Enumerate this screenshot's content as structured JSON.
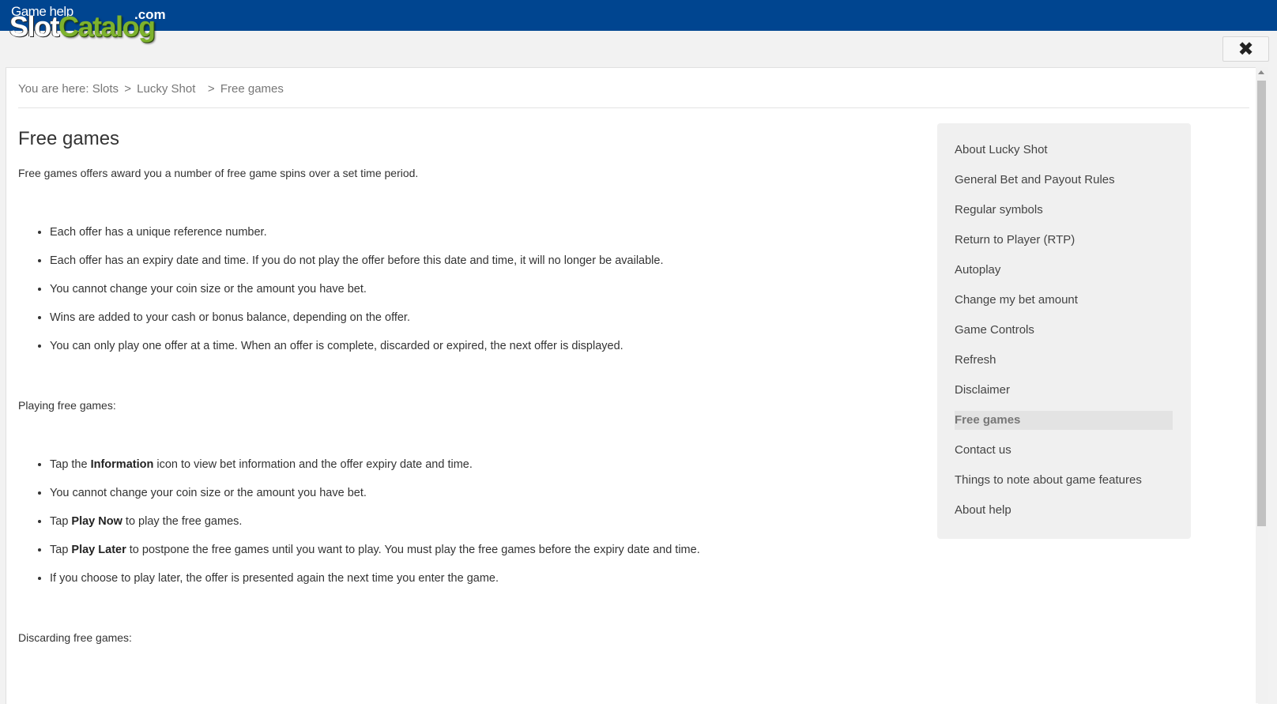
{
  "logo": {
    "small_text": "Game help",
    "dotcom": ".com",
    "word_white": "Slot",
    "word_green": "Catalog"
  },
  "close_icon": "✖",
  "breadcrumb": {
    "prefix": "You are here:",
    "slots": "Slots",
    "game": "Lucky Shot",
    "current": "Free games",
    "separator": ">"
  },
  "page": {
    "title": "Free games",
    "intro": "Free games offers award you a number of free game spins over a set time period.",
    "list1": [
      "Each offer has a unique reference number.",
      "Each offer has an expiry date and time. If you do not play the offer before this date and time, it will no longer be available.",
      "You cannot change your coin size or the amount you have bet.",
      "Wins are added to your cash or bonus balance, depending on the offer.",
      "You can only play one offer at a time. When an offer is complete, discarded or expired, the next offer is displayed."
    ],
    "playing_heading": "Playing free games:",
    "list2": {
      "item1_pre": "Tap the ",
      "item1_bold": "Information",
      "item1_post": " icon to view bet information and the offer expiry date and time.",
      "item2": "You cannot change your coin size or the amount you have bet.",
      "item3_pre": "Tap ",
      "item3_bold": "Play Now",
      "item3_post": " to play the free games.",
      "item4_pre": "Tap ",
      "item4_bold": "Play Later",
      "item4_post": " to postpone the free games until you want to play. You must play the free games before the expiry date and time.",
      "item5": "If you choose to play later, the offer is presented again the next time you enter the game."
    },
    "discarding_heading": "Discarding free games:"
  },
  "sidenav": {
    "items": [
      "About Lucky Shot",
      "General Bet and Payout Rules",
      "Regular symbols",
      "Return to Player (RTP)",
      "Autoplay",
      "Change my bet amount",
      "Game Controls",
      "Refresh",
      "Disclaimer",
      "Free games",
      "Contact us",
      "Things to note about game features",
      "About help"
    ],
    "active_index": 9
  }
}
